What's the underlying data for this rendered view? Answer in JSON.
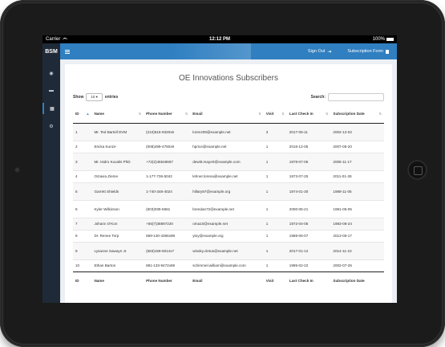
{
  "status_bar": {
    "carrier": "Carrier",
    "time": "12:12 PM",
    "battery": "100%"
  },
  "topbar": {
    "brand": "BSM",
    "signout_label": "Sign Out",
    "form_label": "Subscription Form"
  },
  "sidebar": {
    "items": [
      {
        "icon": "dashboard-icon",
        "glyph": "◉"
      },
      {
        "icon": "comments-icon",
        "glyph": "▬"
      },
      {
        "icon": "table-icon",
        "glyph": "▦"
      },
      {
        "icon": "settings-icon",
        "glyph": "⚙"
      }
    ]
  },
  "page": {
    "title": "OE Innovations Subscribers"
  },
  "controls": {
    "show_label": "Show",
    "length_value": "10",
    "entries_label": "entries",
    "search_label": "Search:"
  },
  "table": {
    "headers": [
      "ID",
      "Name",
      "Phone Number",
      "Email",
      "Visit",
      "Last Check In",
      "Subscription Date"
    ],
    "rows": [
      [
        "1",
        "Mr. Ted Bartell DVM",
        "(210)616-9320x5",
        "lorenz09@example.net",
        "3",
        "2017-06-11",
        "2002-12-02"
      ],
      [
        "2",
        "Ericka Kunze",
        "(008)499-4750x9",
        "hprice@example.net",
        "1",
        "2016-12-05",
        "2007-05-20"
      ],
      [
        "3",
        "Mr. Isidro Kuvalis PhD",
        "+72(2)46548667",
        "dewitt.mayert@example.com",
        "1",
        "1978-07-05",
        "2008-11-17"
      ],
      [
        "4",
        "Octavia Zieme",
        "1-177-736-5042",
        "lehner.lorena@example.net",
        "1",
        "1973-07-25",
        "2011-01-28"
      ],
      [
        "5",
        "Garrett Shields",
        "1-740-348-4024",
        "hillary87@example.org",
        "1",
        "1974-01-30",
        "1989-11-06"
      ],
      [
        "6",
        "Kyler Wilkinson",
        "(503)035-5661",
        "brendan72@example.net",
        "1",
        "2000-05-21",
        "1981-05-05"
      ],
      [
        "7",
        "Johann O'Kon",
        "+55(7)38897220",
        "oma10@example.net",
        "1",
        "1972-04-05",
        "1983-08-24"
      ],
      [
        "8",
        "Dr. Renee Torp",
        "669-130-4366x98",
        "ytoy@example.org",
        "1",
        "1989-06-07",
        "2013-05-17"
      ],
      [
        "9",
        "Lysanne Sawayn Jr.",
        "(583)159-5014x7",
        "wisoky.cletus@example.net",
        "1",
        "2017-01-12",
        "2014-11-10"
      ],
      [
        "10",
        "Ethan Barton",
        "881-133-9472x69",
        "schimmel.william@example.com",
        "1",
        "1995-02-22",
        "2002-07-25"
      ]
    ]
  },
  "colors": {
    "accent": "#2f7fc1",
    "sidebar": "#1f2a38"
  }
}
